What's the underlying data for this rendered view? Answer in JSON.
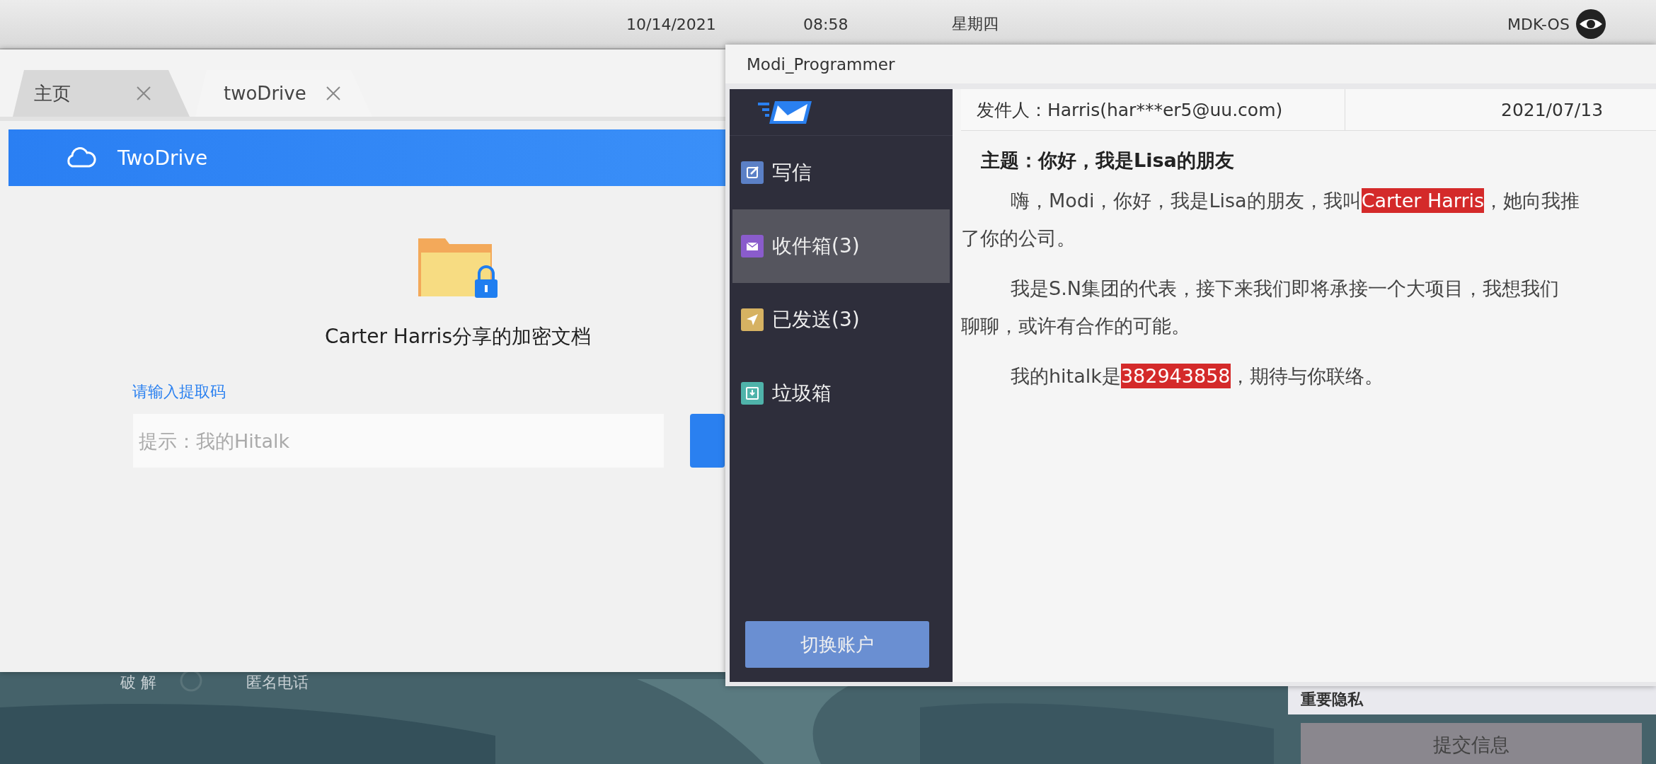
{
  "top_bar": {
    "date": "10/14/2021",
    "time": "08:58",
    "weekday": "星期四",
    "os_name": "MDK-OS"
  },
  "desktop": {
    "labels": [
      "破 解",
      "匿名电话"
    ],
    "panel": {
      "title": "重要隐私",
      "button": "提交信息"
    }
  },
  "drive_window": {
    "tabs": [
      {
        "label": "主页",
        "selected": false
      },
      {
        "label": "twoDrive",
        "selected": true
      }
    ],
    "header": "TwoDrive",
    "document_title": "Carter Harris分享的加密文档",
    "code_label": "请输入提取码",
    "code_field": {
      "placeholder": "提示：我的Hitalk"
    }
  },
  "mail_window": {
    "title": "Modi_Programmer",
    "sidebar": {
      "items": [
        {
          "label": "写信",
          "kind": "compose",
          "color": "#5b80c6",
          "selected": false
        },
        {
          "label": "收件箱(3)",
          "kind": "inbox",
          "color": "#8a5ccc",
          "selected": true
        },
        {
          "label": "已发送(3)",
          "kind": "sent",
          "color": "#d6b262",
          "selected": false
        },
        {
          "label": "垃圾箱",
          "kind": "trash",
          "color": "#4fb3aa",
          "selected": false
        }
      ],
      "switch_account": "切换账户"
    },
    "message": {
      "sender": "发件人：Harris(har***er5@uu.com)",
      "date": "2021/07/13",
      "subject": "主题：你好，我是Lisa的朋友",
      "paragraphs": [
        {
          "lines": [
            [
              {
                "text": "嗨，Modi，你好，我是Lisa的朋友，我叫",
                "highlighted": false
              },
              {
                "text": "Carter Harris",
                "highlighted": true
              },
              {
                "text": " ，她向我推",
                "highlighted": false
              }
            ],
            [
              {
                "text": "了你的公司。",
                "highlighted": false
              }
            ]
          ]
        },
        {
          "lines": [
            [
              {
                "text": "我是S.N集团的代表，接下来我们即将承接一个大项目，我想我们",
                "highlighted": false
              }
            ],
            [
              {
                "text": "聊聊，或许有合作的可能。",
                "highlighted": false
              }
            ]
          ]
        },
        {
          "lines": [
            [
              {
                "text": "我的hitalk是",
                "highlighted": false
              },
              {
                "text": "382943858",
                "highlighted": true
              },
              {
                "text": "，期待与你联络。",
                "highlighted": false
              }
            ]
          ]
        }
      ]
    }
  }
}
